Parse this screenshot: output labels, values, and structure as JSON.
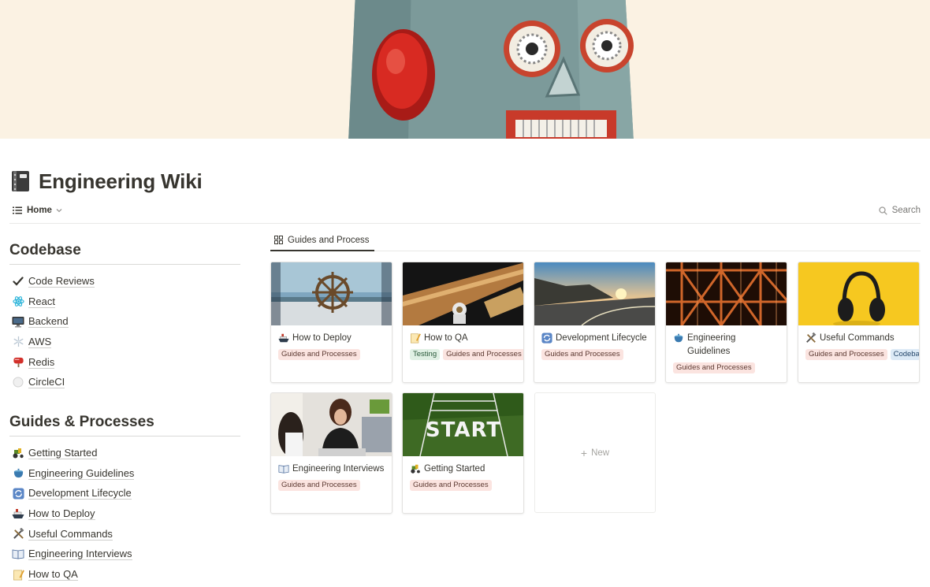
{
  "page": {
    "title": "Engineering Wiki",
    "icon": "notebook-icon"
  },
  "header": {
    "view_label": "Home",
    "search_label": "Search"
  },
  "sidebar": {
    "codebase": {
      "title": "Codebase",
      "items": [
        {
          "label": "Code Reviews",
          "icon": "check-mark-icon"
        },
        {
          "label": "React",
          "icon": "atom-icon"
        },
        {
          "label": "Backend",
          "icon": "monitor-icon"
        },
        {
          "label": "AWS",
          "icon": "snowflake-icon"
        },
        {
          "label": "Redis",
          "icon": "mailbox-icon"
        },
        {
          "label": "CircleCI",
          "icon": "white-circle-icon"
        }
      ]
    },
    "guides": {
      "title": "Guides & Processes",
      "items": [
        {
          "label": "Getting Started",
          "icon": "tractor-icon"
        },
        {
          "label": "Engineering Guidelines",
          "icon": "pot-icon"
        },
        {
          "label": "Development Lifecycle",
          "icon": "cycle-arrows-icon"
        },
        {
          "label": "How to Deploy",
          "icon": "ship-icon"
        },
        {
          "label": "Useful Commands",
          "icon": "tools-icon"
        },
        {
          "label": "Engineering Interviews",
          "icon": "open-book-icon"
        },
        {
          "label": "How to QA",
          "icon": "memo-icon"
        }
      ]
    }
  },
  "gallery": {
    "tab_label": "Guides and Process",
    "cards": [
      {
        "title": "How to Deploy",
        "icon": "ship-icon",
        "tags": [
          "Guides and Processes"
        ]
      },
      {
        "title": "How to QA",
        "icon": "memo-icon",
        "tags": [
          "Testing",
          "Guides and Processes"
        ]
      },
      {
        "title": "Development Lifecycle",
        "icon": "cycle-arrows-icon",
        "tags": [
          "Guides and Processes"
        ]
      },
      {
        "title": "Engineering Guidelines",
        "icon": "pot-icon",
        "tags": [
          "Guides and Processes"
        ]
      },
      {
        "title": "Useful Commands",
        "icon": "tools-icon",
        "tags": [
          "Guides and Processes",
          "Codebase"
        ]
      },
      {
        "title": "Engineering Interviews",
        "icon": "open-book-icon",
        "tags": [
          "Guides and Processes"
        ]
      },
      {
        "title": "Getting Started",
        "icon": "tractor-icon",
        "tags": [
          "Guides and Processes"
        ]
      }
    ],
    "new_label": "New"
  },
  "colors": {
    "text": "#37352f",
    "muted": "#787774",
    "cover_bg": "#fbf2e3",
    "tag_guides": "#fbe4e0",
    "tag_testing": "#e0f0e4",
    "tag_codebase": "#dceaf6"
  }
}
